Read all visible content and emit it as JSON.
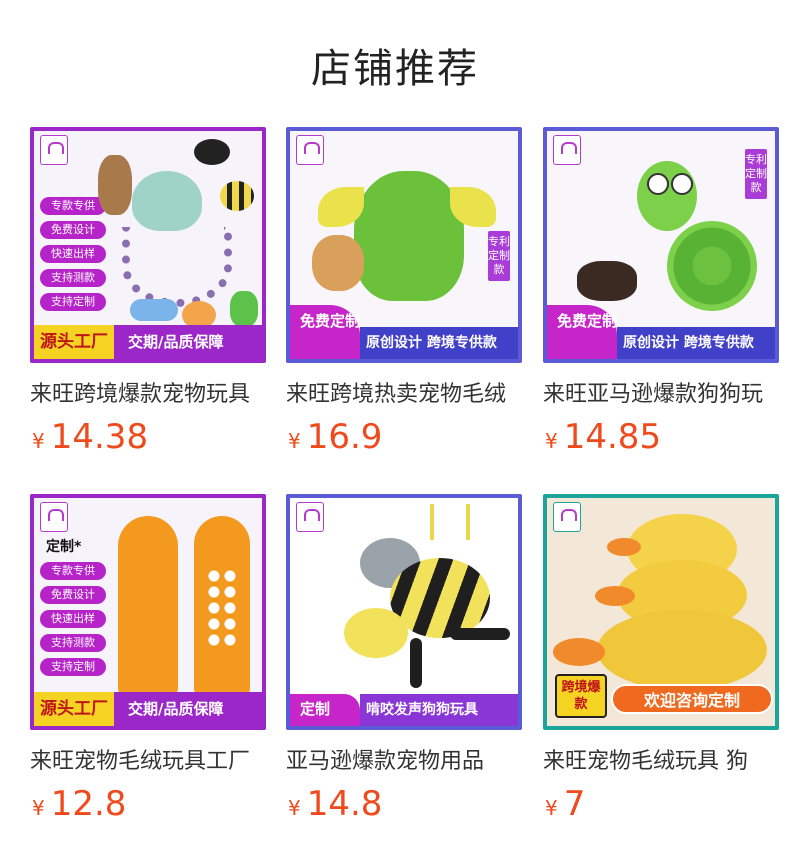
{
  "section_title": "店铺推荐",
  "currency": "¥",
  "products": [
    {
      "name": "来旺跨境爆款宠物玩具",
      "price": "14.38",
      "image_tags": [
        "专款专供",
        "免费设计",
        "快速出样",
        "支持测款",
        "支持定制"
      ],
      "image_banner_left": "源头工厂",
      "image_banner_right": "交期/品质保障"
    },
    {
      "name": "来旺跨境热卖宠物毛绒",
      "price": "16.9",
      "image_badge": "免费定制",
      "image_banner": "原创设计 跨境专供款",
      "image_side_tag": "专利定制款"
    },
    {
      "name": "来旺亚马逊爆款狗狗玩",
      "price": "14.85",
      "image_badge": "免费定制",
      "image_banner": "原创设计 跨境专供款",
      "image_side_tag": "专利定制款"
    },
    {
      "name": "来旺宠物毛绒玩具工厂",
      "price": "12.8",
      "image_heading": "定制*",
      "image_tags": [
        "专款专供",
        "免费设计",
        "快速出样",
        "支持测款",
        "支持定制"
      ],
      "image_banner_left": "源头工厂",
      "image_banner_right": "交期/品质保障"
    },
    {
      "name": "亚马逊爆款宠物用品",
      "price": "14.8",
      "image_badge": "定制",
      "image_banner": "啃咬发声狗狗玩具"
    },
    {
      "name": "来旺宠物毛绒玩具 狗",
      "price": "7",
      "image_badge": "跨境爆款",
      "image_banner": "欢迎咨询定制"
    }
  ],
  "colors": {
    "price": "#ee4a1c",
    "frame_purple": "#9b27c9",
    "frame_blue": "#5b5bd6",
    "frame_teal": "#1ba59a"
  }
}
